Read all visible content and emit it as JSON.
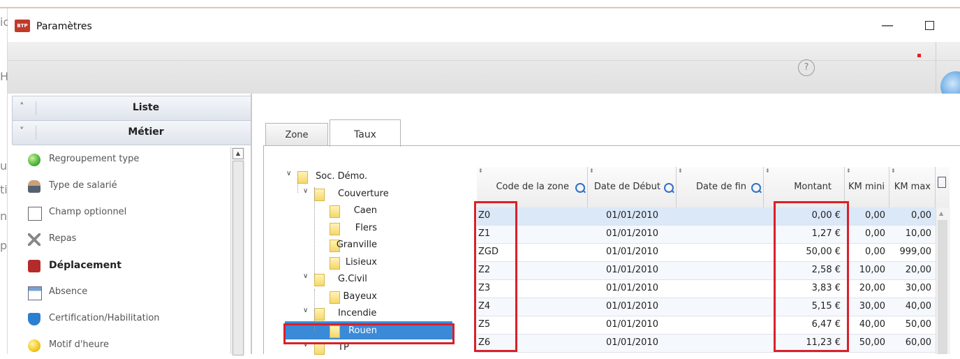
{
  "window": {
    "title": "Paramètres",
    "minimize_glyph": "—",
    "app_icon_label": "BTP",
    "help_glyph": "?"
  },
  "background_chars": [
    "ic",
    "H",
    "u",
    "ti",
    "p",
    "n"
  ],
  "accordion": {
    "liste_label": "Liste",
    "metier_label": "Métier"
  },
  "menu_items": [
    {
      "label": "Regroupement type",
      "icon": "green-ball-icon"
    },
    {
      "label": "Type de salarié",
      "icon": "person-icon"
    },
    {
      "label": "Champ optionnel",
      "icon": "text-field-icon"
    },
    {
      "label": "Repas",
      "icon": "cutlery-icon"
    },
    {
      "label": "Déplacement",
      "icon": "car-icon",
      "active": true
    },
    {
      "label": "Absence",
      "icon": "calendar-icon"
    },
    {
      "label": "Certification/Habilitation",
      "icon": "shield-icon"
    },
    {
      "label": "Motif d'heure",
      "icon": "yellow-ball-icon"
    }
  ],
  "tabs": [
    "Zone",
    "Taux"
  ],
  "active_tab": "Taux",
  "tree": [
    {
      "label": "Soc. Démo.",
      "level": 0,
      "expanded": true
    },
    {
      "label": "Couverture",
      "level": 1,
      "expanded": true
    },
    {
      "label": "Caen",
      "level": 2
    },
    {
      "label": "Flers",
      "level": 2
    },
    {
      "label": "Granville",
      "level": 2
    },
    {
      "label": "Lisieux",
      "level": 2
    },
    {
      "label": "G.Civil",
      "level": 1,
      "expanded": true
    },
    {
      "label": "Bayeux",
      "level": 2
    },
    {
      "label": "Incendie",
      "level": 1,
      "expanded": true
    },
    {
      "label": "Rouen",
      "level": 2,
      "selected": true
    },
    {
      "label": "TP",
      "level": 1,
      "expanded": true
    }
  ],
  "grid": {
    "columns": [
      "Code de la zone",
      "Date de Début",
      "Date de fin",
      "Montant",
      "KM mini",
      "KM max"
    ],
    "rows": [
      [
        "Z0",
        "01/01/2010",
        "",
        "0,00 €",
        "0,00",
        "0,00"
      ],
      [
        "Z1",
        "01/01/2010",
        "",
        "1,27 €",
        "0,00",
        "10,00"
      ],
      [
        "ZGD",
        "01/01/2010",
        "",
        "50,00 €",
        "0,00",
        "999,00"
      ],
      [
        "Z2",
        "01/01/2010",
        "",
        "2,58 €",
        "10,00",
        "20,00"
      ],
      [
        "Z3",
        "01/01/2010",
        "",
        "3,83 €",
        "20,00",
        "30,00"
      ],
      [
        "Z4",
        "01/01/2010",
        "",
        "5,15 €",
        "30,00",
        "40,00"
      ],
      [
        "Z5",
        "01/01/2010",
        "",
        "6,47 €",
        "40,00",
        "50,00"
      ],
      [
        "Z6",
        "01/01/2010",
        "",
        "11,23 €",
        "50,00",
        "60,00"
      ]
    ]
  },
  "colors": {
    "highlight_red": "#d9202a",
    "selection_blue": "#3a8ad8",
    "first_row_blue": "#dbe8f7"
  }
}
